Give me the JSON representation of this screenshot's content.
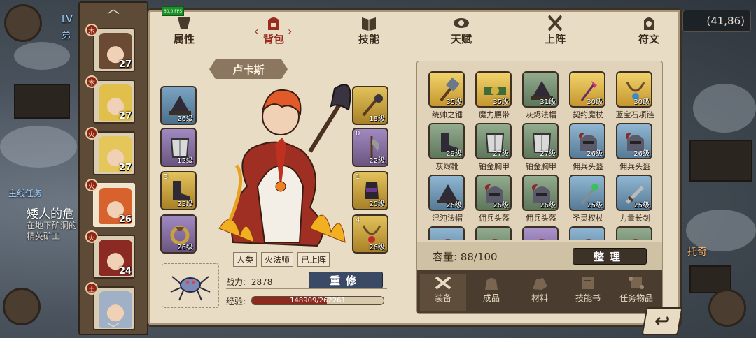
{
  "hud": {
    "fps": "60.0 FPS",
    "level_prefix": "LV",
    "level_sub": "弟",
    "coords": "(41,86)",
    "quest_title": "主线任务",
    "quest_name": "矮人的危",
    "quest_desc": "在地下矿洞的精英矿工",
    "side_label": "托奇"
  },
  "heroes": [
    {
      "level": "27",
      "badge": "木",
      "face_color": "#6b4a33",
      "active": false
    },
    {
      "level": "27",
      "badge": "木",
      "face_color": "#e0c04a",
      "active": false
    },
    {
      "level": "27",
      "badge": "火",
      "face_color": "#e5c65a",
      "active": false
    },
    {
      "level": "26",
      "badge": "火",
      "face_color": "#d8622d",
      "active": true
    },
    {
      "level": "24",
      "badge": "火",
      "face_color": "#8a2a22",
      "active": false
    },
    {
      "level": "",
      "badge": "土",
      "face_color": "#9fb0c7",
      "active": false
    }
  ],
  "tabs": [
    {
      "label": "属性",
      "icon": "attribute-icon",
      "active": false
    },
    {
      "label": "背包",
      "icon": "backpack-icon",
      "active": true
    },
    {
      "label": "技能",
      "icon": "skill-book-icon",
      "active": false
    },
    {
      "label": "天赋",
      "icon": "talent-eye-icon",
      "active": false
    },
    {
      "label": "上阵",
      "icon": "crossed-swords-icon",
      "active": false
    },
    {
      "label": "符文",
      "icon": "rune-icon",
      "active": false
    }
  ],
  "character": {
    "name": "卢卡斯",
    "tags": [
      "人类",
      "火法师",
      "已上阵"
    ],
    "power_label": "战力:",
    "power_value": "2878",
    "reset_label": "重修",
    "exp_label": "经验:",
    "exp_text": "148909/262261",
    "exp_current": 148909,
    "exp_max": 262261
  },
  "equip_left": [
    {
      "level": "26级",
      "rarity": "blue",
      "num": "",
      "icon": "hat-icon"
    },
    {
      "level": "12级",
      "rarity": "purple",
      "num": "",
      "icon": "chest-icon"
    },
    {
      "level": "23级",
      "rarity": "gold",
      "num": "3",
      "icon": "boots-icon"
    },
    {
      "level": "26级",
      "rarity": "purple",
      "num": "",
      "icon": "ring-icon"
    }
  ],
  "equip_right": [
    {
      "level": "18级",
      "rarity": "gold",
      "num": "",
      "icon": "staff-icon"
    },
    {
      "level": "22级",
      "rarity": "purple",
      "num": "0",
      "icon": "axe-icon"
    },
    {
      "level": "20级",
      "rarity": "gold",
      "num": "1",
      "icon": "glove-icon"
    },
    {
      "level": "26级",
      "rarity": "gold",
      "num": "4",
      "icon": "amulet-icon"
    }
  ],
  "inventory": {
    "items": [
      {
        "name": "统帅之锤",
        "level": "35级",
        "rarity": "gold",
        "icon": "hammer-icon"
      },
      {
        "name": "魔力腰带",
        "level": "35级",
        "rarity": "gold",
        "icon": "belt-icon"
      },
      {
        "name": "灰烬法帽",
        "level": "31级",
        "rarity": "green",
        "icon": "hat-icon"
      },
      {
        "name": "契约魔杖",
        "level": "30级",
        "rarity": "gold",
        "icon": "wand-icon"
      },
      {
        "name": "蓝宝石项链",
        "level": "30级",
        "rarity": "gold",
        "icon": "necklace-icon"
      },
      {
        "name": "灰烬靴",
        "level": "29级",
        "rarity": "green",
        "icon": "boots-icon"
      },
      {
        "name": "铂金胸甲",
        "level": "27级",
        "rarity": "green",
        "icon": "armor-icon"
      },
      {
        "name": "铂金胸甲",
        "level": "27级",
        "rarity": "green",
        "icon": "armor-icon"
      },
      {
        "name": "佣兵头盔",
        "level": "26级",
        "rarity": "blue",
        "icon": "helmet-icon"
      },
      {
        "name": "佣兵头盔",
        "level": "26级",
        "rarity": "blue",
        "icon": "helmet-icon"
      },
      {
        "name": "混沌法帽",
        "level": "26级",
        "rarity": "blue",
        "icon": "hat-icon"
      },
      {
        "name": "佣兵头盔",
        "level": "26级",
        "rarity": "green",
        "icon": "helmet-icon"
      },
      {
        "name": "佣兵头盔",
        "level": "26级",
        "rarity": "green",
        "icon": "helmet-icon"
      },
      {
        "name": "圣灵权杖",
        "level": "25级",
        "rarity": "blue",
        "icon": "scepter-icon"
      },
      {
        "name": "力量长剑",
        "level": "25级",
        "rarity": "blue",
        "icon": "sword-icon"
      },
      {
        "name": "",
        "level": "",
        "rarity": "blue",
        "icon": "item-icon"
      },
      {
        "name": "",
        "level": "",
        "rarity": "green",
        "icon": "item-icon"
      },
      {
        "name": "",
        "level": "",
        "rarity": "purple",
        "icon": "item-icon"
      },
      {
        "name": "",
        "level": "",
        "rarity": "blue",
        "icon": "item-icon"
      },
      {
        "name": "",
        "level": "",
        "rarity": "green",
        "icon": "item-icon"
      }
    ],
    "capacity_label": "容量: 88/100",
    "sort_label": "整理",
    "categories": [
      {
        "label": "装备",
        "icon": "equipment-icon",
        "active": true
      },
      {
        "label": "成品",
        "icon": "bag-icon",
        "active": false
      },
      {
        "label": "材料",
        "icon": "ore-icon",
        "active": false
      },
      {
        "label": "技能书",
        "icon": "skill-book-icon",
        "active": false
      },
      {
        "label": "任务物品",
        "icon": "scroll-icon",
        "active": false
      }
    ]
  },
  "colors": {
    "panel_bg": "#e8dcc5",
    "accent_red": "#9b2a1f",
    "rarity_gold": "#d9b04a",
    "rarity_blue": "#6f94b0",
    "rarity_green": "#789174",
    "rarity_purple": "#8f79ad"
  }
}
